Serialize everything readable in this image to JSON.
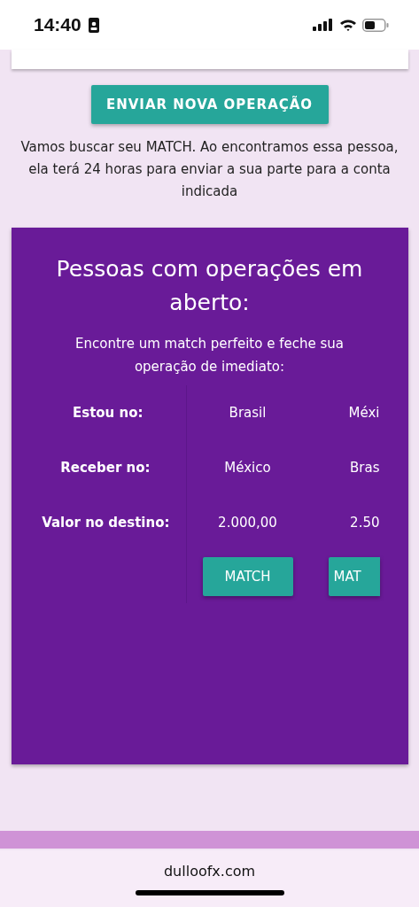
{
  "status_bar": {
    "time": "14:40"
  },
  "primary_button": "ENVIAR NOVA OPERAÇÃO",
  "info_text": "Vamos buscar seu MATCH. Ao encontramos essa pessoa, ela terá 24 horas para enviar a sua parte para a conta indicada",
  "card": {
    "title": "Pessoas com operações em aberto:",
    "subtitle": "Encontre um match perfeito e feche sua operação de imediato:",
    "row_labels": [
      "Estou no:",
      "Receber no:",
      "Valor no destino:"
    ],
    "offers": [
      {
        "values": [
          "Brasil",
          "México",
          "2.000,00"
        ],
        "button": "MATCH",
        "clipped": false
      },
      {
        "values": [
          "Méxi",
          "Bras",
          "2.50"
        ],
        "button": "MAT",
        "clipped": true
      }
    ]
  },
  "browser": {
    "url": "dulloofx.com"
  }
}
